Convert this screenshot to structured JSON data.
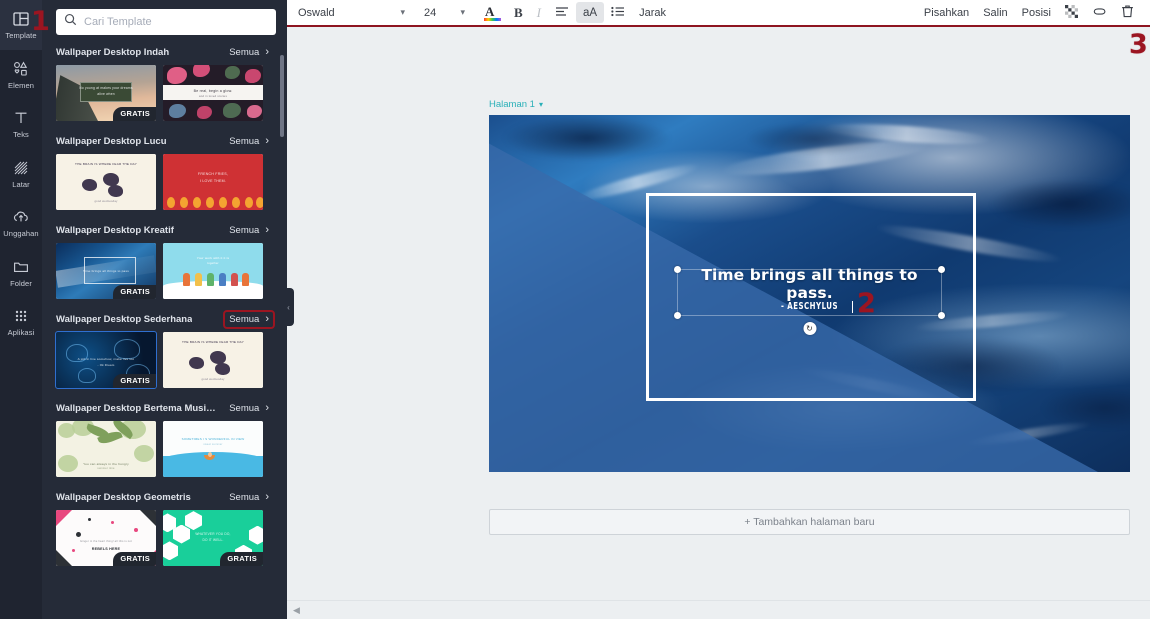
{
  "rail": {
    "items": [
      {
        "label": "Template",
        "icon": "template-icon",
        "active": true
      },
      {
        "label": "Elemen",
        "icon": "elements-icon",
        "active": false
      },
      {
        "label": "Teks",
        "icon": "text-icon",
        "active": false
      },
      {
        "label": "Latar",
        "icon": "background-icon",
        "active": false
      },
      {
        "label": "Unggahan",
        "icon": "upload-icon",
        "active": false
      },
      {
        "label": "Folder",
        "icon": "folder-icon",
        "active": false
      },
      {
        "label": "Aplikasi",
        "icon": "apps-icon",
        "active": false
      }
    ]
  },
  "search": {
    "placeholder": "Cari Template",
    "value": ""
  },
  "templates": {
    "see_all_label": "Semua",
    "free_badge": "GRATIS",
    "groups": [
      {
        "title": "Wallpaper Desktop Indah",
        "highlight": false,
        "items": [
          {
            "art": "mountain",
            "free": true,
            "selected": false,
            "line1": "No young at makes your dreams",
            "line2": "alive when"
          },
          {
            "art": "floral",
            "free": false,
            "selected": false,
            "line1": "Be real, begin a glow.",
            "line2": "and in loved  stories"
          }
        ]
      },
      {
        "title": "Wallpaper Desktop Lucu",
        "highlight": false,
        "items": [
          {
            "art": "cream",
            "free": false,
            "selected": false,
            "line1": "THE BRAIN IS WHERE FEAR THE DAY",
            "line2": "good  wednesday"
          },
          {
            "art": "red",
            "free": false,
            "selected": false,
            "line1": "FRENCH FRIES,",
            "line2": "I LOVE THEM."
          }
        ]
      },
      {
        "title": "Wallpaper Desktop Kreatif",
        "highlight": false,
        "items": [
          {
            "art": "ocean",
            "free": true,
            "selected": false,
            "line1": "Time brings all things to pass",
            "line2": ""
          },
          {
            "art": "sky",
            "free": false,
            "selected": false,
            "line1": "Your work with it it is",
            "line2": "together"
          }
        ]
      },
      {
        "title": "Wallpaper Desktop Sederhana",
        "highlight": true,
        "items": [
          {
            "art": "jelly",
            "free": true,
            "selected": true,
            "line1": "A job in live somehow, make live too",
            "line2": "- Ok Dream"
          },
          {
            "art": "cream",
            "free": false,
            "selected": false,
            "line1": "THE BRAIN IS WHERE FEAR THE DAY",
            "line2": "good  wednesday"
          }
        ]
      },
      {
        "title": "Wallpaper Desktop Bertema Musim Pan...",
        "highlight": false,
        "items": [
          {
            "art": "palm",
            "free": false,
            "selected": false,
            "line1": "You can always in the hungry",
            "line2": "summer time"
          },
          {
            "art": "beach",
            "free": false,
            "selected": false,
            "line1": "SOMETIMES I S  WONDERFUL IN VIEW",
            "line2": "sweet summer"
          }
        ]
      },
      {
        "title": "Wallpaper Desktop Geometris",
        "highlight": false,
        "items": [
          {
            "art": "geo",
            "free": true,
            "selected": false,
            "line1": "Ginger in the heart thing! all this is not",
            "line2": "REBELS HERE"
          },
          {
            "art": "mint",
            "free": true,
            "selected": false,
            "line1": "WHATEVER YOU DO,",
            "line2": "DO IT WELL."
          }
        ]
      }
    ]
  },
  "toolbar": {
    "font_name": "Oswald",
    "font_size": "24",
    "color_letter": "A",
    "bold_label": "B",
    "italic_label": "I",
    "case_label": "aA",
    "spacing_label": "Jarak",
    "split_label": "Pisahkan",
    "copy_label": "Salin",
    "position_label": "Posisi"
  },
  "canvas": {
    "page_label": "Halaman 1",
    "quote": "Time brings all things to pass.",
    "author": "- AESCHYLUS",
    "add_page_label": "+ Tambahkan halaman baru"
  },
  "annotations": {
    "one": "1",
    "two": "2",
    "three": "3"
  },
  "colors": {
    "annotation_red": "#9b1521",
    "rail_bg": "#1f2430",
    "panel_bg": "#252b38",
    "toolbar_underline": "#8e1420",
    "page_label_teal": "#2ab0b8",
    "selection_blue": "#2f6fd0"
  }
}
